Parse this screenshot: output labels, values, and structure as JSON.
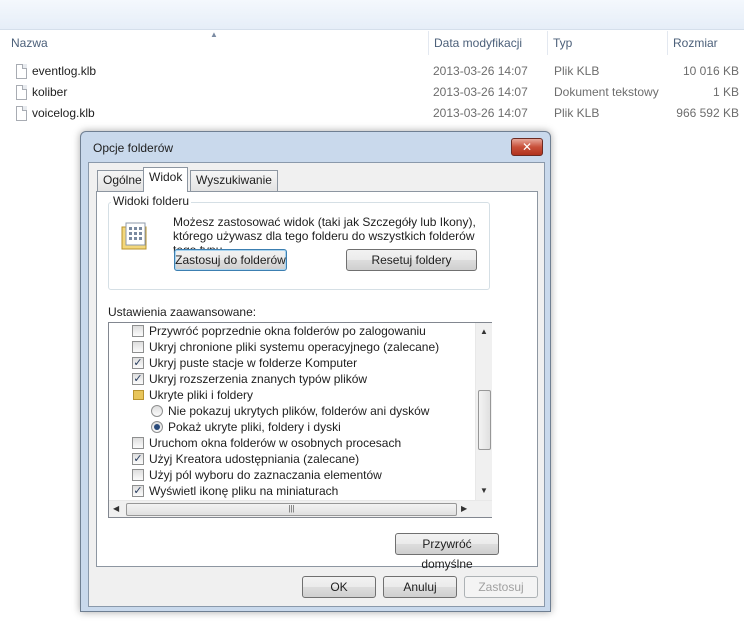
{
  "explorer": {
    "columns": [
      {
        "label": "Nazwa"
      },
      {
        "label": "Data modyfikacji"
      },
      {
        "label": "Typ"
      },
      {
        "label": "Rozmiar"
      }
    ],
    "files": [
      {
        "name": "eventlog.klb",
        "date": "2013-03-26 14:07",
        "type": "Plik KLB",
        "size": "10 016 KB"
      },
      {
        "name": "koliber",
        "date": "2013-03-26 14:07",
        "type": "Dokument tekstowy",
        "size": "1 KB"
      },
      {
        "name": "voicelog.klb",
        "date": "2013-03-26 14:07",
        "type": "Plik KLB",
        "size": "966 592 KB"
      }
    ]
  },
  "dialog": {
    "title": "Opcje folderów",
    "close_label": "✕",
    "tabs": [
      {
        "label": "Ogólne"
      },
      {
        "label": "Widok"
      },
      {
        "label": "Wyszukiwanie"
      }
    ],
    "folder_views": {
      "legend": "Widoki folderu",
      "description": "Możesz zastosować widok (taki jak Szczegóły lub Ikony), którego używasz dla tego folderu do wszystkich folderów tego typu.",
      "apply_button": "Zastosuj do folderów",
      "reset_button": "Resetuj foldery"
    },
    "advanced_label": "Ustawienia zaawansowane:",
    "settings": [
      {
        "kind": "checkbox",
        "checked": false,
        "label": "Przywróć poprzednie okna folderów po zalogowaniu"
      },
      {
        "kind": "checkbox",
        "checked": false,
        "label": "Ukryj chronione pliki systemu operacyjnego (zalecane)"
      },
      {
        "kind": "checkbox",
        "checked": true,
        "label": "Ukryj puste stacje w folderze Komputer"
      },
      {
        "kind": "checkbox",
        "checked": true,
        "label": "Ukryj rozszerzenia znanych typów plików"
      },
      {
        "kind": "folder",
        "label": "Ukryte pliki i foldery"
      },
      {
        "kind": "radio",
        "checked": false,
        "label": "Nie pokazuj ukrytych plików, folderów ani dysków"
      },
      {
        "kind": "radio",
        "checked": true,
        "label": "Pokaż ukryte pliki, foldery i dyski"
      },
      {
        "kind": "checkbox",
        "checked": false,
        "label": "Uruchom okna folderów w osobnych procesach"
      },
      {
        "kind": "checkbox",
        "checked": true,
        "label": "Użyj Kreatora udostępniania (zalecane)"
      },
      {
        "kind": "checkbox",
        "checked": false,
        "label": "Użyj pól wyboru do zaznaczania elementów"
      },
      {
        "kind": "checkbox",
        "checked": true,
        "label": "Wyświetl ikonę pliku na miniaturach"
      }
    ],
    "restore_defaults_button": "Przywróć domyślne",
    "ok_button": "OK",
    "cancel_button": "Anuluj",
    "apply_button": "Zastosuj"
  }
}
